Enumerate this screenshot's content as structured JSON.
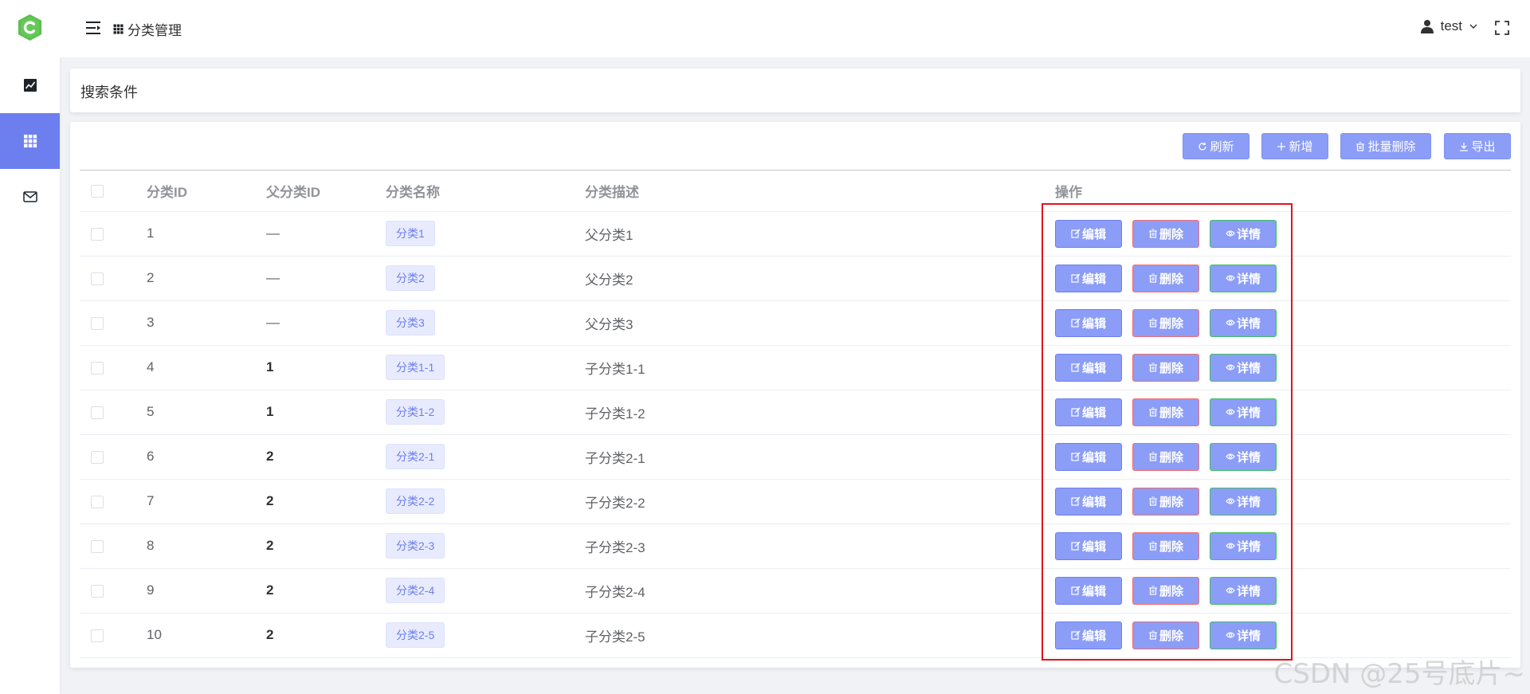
{
  "header": {
    "breadcrumb": "分类管理",
    "user_name": "test"
  },
  "search": {
    "title": "搜索条件"
  },
  "toolbar": {
    "refresh_label": "刷新",
    "add_label": "新增",
    "batch_delete_label": "批量删除",
    "export_label": "导出"
  },
  "table": {
    "headers": {
      "id": "分类ID",
      "parent_id": "父分类ID",
      "name": "分类名称",
      "desc": "分类描述",
      "ops": "操作"
    },
    "rows": [
      {
        "id": "1",
        "parent_id": "—",
        "name": "分类1",
        "desc": "父分类1"
      },
      {
        "id": "2",
        "parent_id": "—",
        "name": "分类2",
        "desc": "父分类2"
      },
      {
        "id": "3",
        "parent_id": "—",
        "name": "分类3",
        "desc": "父分类3"
      },
      {
        "id": "4",
        "parent_id": "1",
        "name": "分类1-1",
        "desc": "子分类1-1"
      },
      {
        "id": "5",
        "parent_id": "1",
        "name": "分类1-2",
        "desc": "子分类1-2"
      },
      {
        "id": "6",
        "parent_id": "2",
        "name": "分类2-1",
        "desc": "子分类2-1"
      },
      {
        "id": "7",
        "parent_id": "2",
        "name": "分类2-2",
        "desc": "子分类2-2"
      },
      {
        "id": "8",
        "parent_id": "2",
        "name": "分类2-3",
        "desc": "子分类2-3"
      },
      {
        "id": "9",
        "parent_id": "2",
        "name": "分类2-4",
        "desc": "子分类2-4"
      },
      {
        "id": "10",
        "parent_id": "2",
        "name": "分类2-5",
        "desc": "子分类2-5"
      }
    ],
    "row_ops": {
      "edit_label": "编辑",
      "delete_label": "删除",
      "view_label": "详情"
    }
  },
  "sidebar": {
    "items": [
      {
        "icon": "chart-icon"
      },
      {
        "icon": "grid-icon",
        "active": true
      },
      {
        "icon": "mail-icon"
      }
    ]
  },
  "watermark": "CSDN @25号底片~",
  "colors": {
    "accent": "#6d7fee",
    "button": "#8b9df7",
    "highlight": "#e0141e"
  }
}
